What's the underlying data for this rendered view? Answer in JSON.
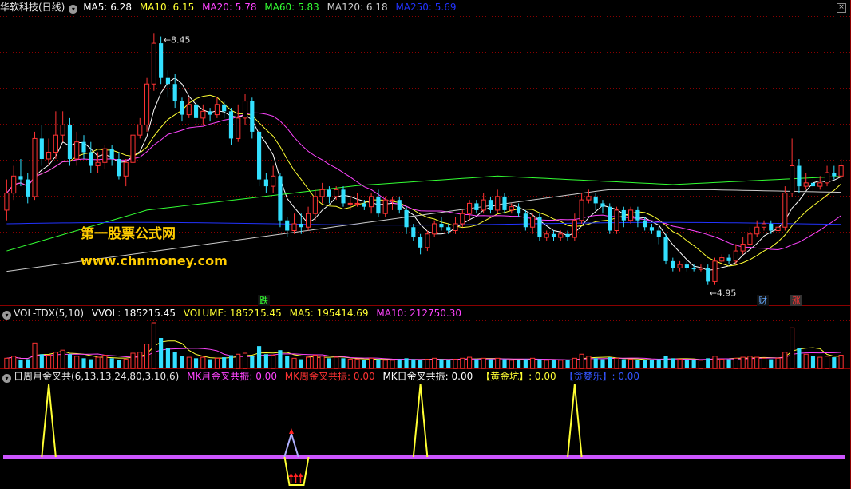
{
  "main_header": {
    "title": "华软科技(日线)",
    "items": [
      {
        "label": "MA5: 6.28",
        "color": "#ffffff"
      },
      {
        "label": "MA10: 6.15",
        "color": "#ffff33"
      },
      {
        "label": "MA20: 5.78",
        "color": "#ff44ff"
      },
      {
        "label": "MA60: 5.83",
        "color": "#33ff33"
      },
      {
        "label": "MA120: 6.18",
        "color": "#cccccc"
      },
      {
        "label": "MA250: 5.69",
        "color": "#2233ff"
      }
    ]
  },
  "vol_header": {
    "title": "VOL-TDX(5,10)",
    "items": [
      {
        "label": "VVOL: 185215.45",
        "color": "#ffffff"
      },
      {
        "label": "VOLUME: 185215.45",
        "color": "#ffff33"
      },
      {
        "label": "MA5: 195414.69",
        "color": "#ffff33"
      },
      {
        "label": "MA10: 212750.30",
        "color": "#ff44ff"
      }
    ]
  },
  "ind_header": {
    "title": "日周月金叉共(6,13,13,24,80,3,10,6)",
    "items": [
      {
        "label": "MK月金叉共振: 0.00",
        "color": "#ff44ff"
      },
      {
        "label": "MK周金叉共振: 0.00",
        "color": "#ff3333"
      },
      {
        "label": "MK日金叉共振: 0.00",
        "color": "#ffffff"
      },
      {
        "label": "【黄金坑】: 0.00",
        "color": "#ffff33"
      },
      {
        "label": "【贪婪乐】: 0.00",
        "color": "#3355ff"
      }
    ]
  },
  "watermark": {
    "line1": "第一股票公式网",
    "line2": "www.chnmoney.com"
  },
  "colors": {
    "up": "#ff3333",
    "down": "#33e0ff",
    "bg": "#000000",
    "grid": "#8b0000"
  },
  "chart_data": [
    {
      "type": "candlestick",
      "title": "华软科技(日线)",
      "ylim": [
        4.5,
        8.7
      ],
      "high_annotation": "8.45",
      "low_annotation": "4.95",
      "markers": [
        "跌",
        "财",
        "涨"
      ],
      "candles": [
        [
          5.85,
          6.1,
          6.3,
          5.7
        ],
        [
          6.1,
          6.35,
          6.5,
          6.0
        ],
        [
          6.35,
          6.3,
          6.6,
          6.2
        ],
        [
          6.3,
          6.05,
          6.4,
          5.95
        ],
        [
          6.05,
          6.9,
          7.0,
          6.0
        ],
        [
          6.9,
          6.6,
          7.1,
          6.5
        ],
        [
          6.6,
          6.7,
          6.9,
          6.5
        ],
        [
          6.7,
          6.95,
          7.3,
          6.6
        ],
        [
          6.95,
          7.1,
          7.3,
          6.85
        ],
        [
          7.1,
          6.6,
          7.2,
          6.5
        ],
        [
          6.6,
          6.85,
          7.0,
          6.5
        ],
        [
          6.85,
          6.7,
          6.95,
          6.6
        ],
        [
          6.7,
          6.5,
          6.85,
          6.4
        ],
        [
          6.5,
          6.55,
          6.7,
          6.4
        ],
        [
          6.55,
          6.75,
          6.8,
          6.45
        ],
        [
          6.75,
          6.6,
          6.8,
          6.5
        ],
        [
          6.6,
          6.35,
          6.7,
          6.3
        ],
        [
          6.35,
          6.55,
          6.6,
          6.2
        ],
        [
          6.55,
          6.95,
          7.05,
          6.5
        ],
        [
          6.95,
          7.1,
          7.2,
          6.9
        ],
        [
          7.1,
          7.7,
          7.8,
          7.0
        ],
        [
          7.7,
          8.3,
          8.45,
          7.6
        ],
        [
          8.3,
          7.8,
          8.4,
          7.7
        ],
        [
          7.8,
          7.7,
          7.9,
          7.5
        ],
        [
          7.7,
          7.45,
          7.85,
          7.35
        ],
        [
          7.45,
          7.25,
          7.5,
          7.15
        ],
        [
          7.25,
          7.4,
          7.5,
          7.2
        ],
        [
          7.4,
          7.2,
          7.5,
          7.1
        ],
        [
          7.2,
          7.3,
          7.4,
          7.1
        ],
        [
          7.3,
          7.25,
          7.35,
          7.15
        ],
        [
          7.25,
          7.4,
          7.5,
          7.2
        ],
        [
          7.4,
          7.3,
          7.45,
          7.2
        ],
        [
          7.3,
          6.9,
          7.35,
          6.8
        ],
        [
          6.9,
          7.2,
          7.4,
          6.85
        ],
        [
          7.2,
          7.45,
          7.55,
          7.1
        ],
        [
          7.45,
          7.0,
          7.5,
          6.9
        ],
        [
          7.0,
          6.3,
          7.05,
          6.2
        ],
        [
          6.3,
          6.2,
          6.4,
          6.1
        ],
        [
          6.2,
          6.35,
          6.5,
          6.1
        ],
        [
          6.35,
          5.7,
          6.4,
          5.6
        ],
        [
          5.7,
          5.55,
          5.75,
          5.45
        ],
        [
          5.55,
          5.65,
          5.8,
          5.5
        ],
        [
          5.65,
          5.6,
          5.8,
          5.5
        ],
        [
          5.6,
          5.8,
          5.9,
          5.55
        ],
        [
          5.8,
          6.05,
          6.15,
          5.7
        ],
        [
          6.05,
          6.15,
          6.25,
          5.95
        ],
        [
          6.15,
          6.05,
          6.2,
          5.95
        ],
        [
          6.05,
          6.15,
          6.2,
          6.0
        ],
        [
          6.15,
          5.95,
          6.2,
          5.9
        ],
        [
          5.95,
          5.95,
          6.05,
          5.85
        ],
        [
          5.95,
          5.95,
          6.1,
          5.9
        ],
        [
          5.95,
          5.9,
          6.0,
          5.85
        ],
        [
          5.9,
          6.05,
          6.1,
          5.8
        ],
        [
          6.05,
          5.8,
          6.15,
          5.75
        ],
        [
          5.8,
          6.0,
          6.05,
          5.75
        ],
        [
          6.0,
          6.0,
          6.05,
          5.85
        ],
        [
          6.0,
          5.85,
          6.05,
          5.8
        ],
        [
          5.85,
          5.6,
          5.9,
          5.5
        ],
        [
          5.6,
          5.45,
          5.65,
          5.4
        ],
        [
          5.45,
          5.3,
          5.5,
          5.2
        ],
        [
          5.3,
          5.5,
          5.55,
          5.25
        ],
        [
          5.5,
          5.65,
          5.7,
          5.45
        ],
        [
          5.65,
          5.6,
          5.75,
          5.55
        ],
        [
          5.6,
          5.55,
          5.65,
          5.5
        ],
        [
          5.55,
          5.65,
          5.75,
          5.5
        ],
        [
          5.65,
          5.8,
          5.85,
          5.6
        ],
        [
          5.8,
          5.95,
          6.0,
          5.7
        ],
        [
          5.95,
          5.85,
          6.0,
          5.8
        ],
        [
          5.85,
          6.0,
          6.1,
          5.8
        ],
        [
          6.0,
          5.85,
          6.05,
          5.8
        ],
        [
          5.85,
          6.05,
          6.15,
          5.8
        ],
        [
          6.05,
          5.85,
          6.1,
          5.8
        ],
        [
          5.85,
          5.9,
          5.95,
          5.8
        ],
        [
          5.9,
          5.8,
          5.95,
          5.75
        ],
        [
          5.8,
          5.6,
          5.85,
          5.55
        ],
        [
          5.6,
          5.75,
          5.8,
          5.5
        ],
        [
          5.75,
          5.45,
          5.8,
          5.4
        ],
        [
          5.45,
          5.5,
          5.55,
          5.4
        ],
        [
          5.5,
          5.45,
          5.55,
          5.4
        ],
        [
          5.45,
          5.5,
          5.55,
          5.4
        ],
        [
          5.5,
          5.45,
          5.55,
          5.4
        ],
        [
          5.45,
          5.7,
          5.8,
          5.4
        ],
        [
          5.7,
          6.0,
          6.1,
          5.65
        ],
        [
          6.0,
          6.05,
          6.15,
          5.95
        ],
        [
          6.05,
          5.95,
          6.1,
          5.85
        ],
        [
          5.95,
          5.9,
          6.0,
          5.8
        ],
        [
          5.9,
          5.55,
          5.95,
          5.5
        ],
        [
          5.55,
          5.85,
          5.9,
          5.5
        ],
        [
          5.85,
          5.7,
          5.9,
          5.6
        ],
        [
          5.7,
          5.85,
          5.9,
          5.65
        ],
        [
          5.85,
          5.7,
          5.9,
          5.6
        ],
        [
          5.7,
          5.6,
          5.75,
          5.55
        ],
        [
          5.6,
          5.55,
          5.65,
          5.5
        ],
        [
          5.55,
          5.45,
          5.6,
          5.35
        ],
        [
          5.45,
          5.1,
          5.5,
          5.05
        ],
        [
          5.1,
          5.0,
          5.15,
          4.95
        ],
        [
          5.0,
          5.05,
          5.1,
          4.95
        ],
        [
          5.05,
          5.0,
          5.1,
          4.95
        ],
        [
          5.0,
          4.98,
          5.05,
          4.95
        ],
        [
          4.98,
          5.0,
          5.05,
          4.95
        ],
        [
          5.0,
          4.8,
          5.05,
          4.75
        ],
        [
          4.8,
          5.1,
          5.15,
          4.75
        ],
        [
          5.1,
          5.15,
          5.2,
          5.05
        ],
        [
          5.15,
          5.1,
          5.2,
          5.05
        ],
        [
          5.1,
          5.25,
          5.35,
          5.05
        ],
        [
          5.25,
          5.35,
          5.45,
          5.2
        ],
        [
          5.35,
          5.5,
          5.6,
          5.3
        ],
        [
          5.5,
          5.6,
          5.7,
          5.45
        ],
        [
          5.6,
          5.65,
          5.7,
          5.55
        ],
        [
          5.65,
          5.55,
          5.7,
          5.5
        ],
        [
          5.55,
          5.6,
          5.7,
          5.5
        ],
        [
          5.6,
          6.1,
          6.2,
          5.55
        ],
        [
          6.1,
          6.5,
          6.9,
          6.05
        ],
        [
          6.5,
          6.2,
          6.6,
          6.1
        ],
        [
          6.2,
          6.25,
          6.4,
          6.15
        ],
        [
          6.25,
          6.2,
          6.35,
          6.1
        ],
        [
          6.2,
          6.25,
          6.35,
          6.15
        ],
        [
          6.25,
          6.4,
          6.5,
          6.2
        ],
        [
          6.4,
          6.35,
          6.5,
          6.3
        ],
        [
          6.35,
          6.5,
          6.6,
          6.3
        ]
      ],
      "series": [
        {
          "name": "MA5",
          "color": "#ffffff"
        },
        {
          "name": "MA10",
          "color": "#ffff33"
        },
        {
          "name": "MA20",
          "color": "#ff44ff"
        },
        {
          "name": "MA60",
          "color": "#33ff33"
        },
        {
          "name": "MA120",
          "color": "#cccccc"
        },
        {
          "name": "MA250",
          "color": "#2233ff"
        }
      ]
    },
    {
      "type": "bar",
      "title": "VOL-TDX(5,10)",
      "values": [
        10,
        12,
        8,
        9,
        25,
        14,
        13,
        16,
        18,
        14,
        12,
        10,
        9,
        11,
        13,
        10,
        8,
        9,
        15,
        16,
        24,
        45,
        30,
        20,
        16,
        12,
        11,
        10,
        11,
        9,
        10,
        11,
        13,
        14,
        15,
        12,
        22,
        14,
        13,
        18,
        12,
        10,
        9,
        11,
        13,
        12,
        10,
        11,
        10,
        9,
        9,
        8,
        10,
        9,
        8,
        8,
        9,
        10,
        9,
        8,
        9,
        10,
        9,
        8,
        9,
        10,
        11,
        9,
        10,
        9,
        10,
        9,
        8,
        8,
        9,
        10,
        9,
        8,
        8,
        8,
        8,
        10,
        14,
        12,
        10,
        9,
        11,
        10,
        9,
        9,
        8,
        8,
        8,
        9,
        12,
        10,
        9,
        8,
        8,
        8,
        10,
        12,
        9,
        9,
        10,
        11,
        12,
        11,
        10,
        9,
        10,
        16,
        40,
        20,
        14,
        12,
        11,
        12,
        11,
        13
      ],
      "series": [
        {
          "name": "MA5",
          "color": "#ffff33"
        },
        {
          "name": "MA10",
          "color": "#ff44ff"
        }
      ]
    },
    {
      "type": "line",
      "title": "日周月金叉共(6,13,13,24,80,3,10,6)",
      "spikes_yellow": [
        6,
        59,
        81
      ],
      "spike_purple": [
        40
      ],
      "pit_yellow": [
        41
      ]
    }
  ]
}
